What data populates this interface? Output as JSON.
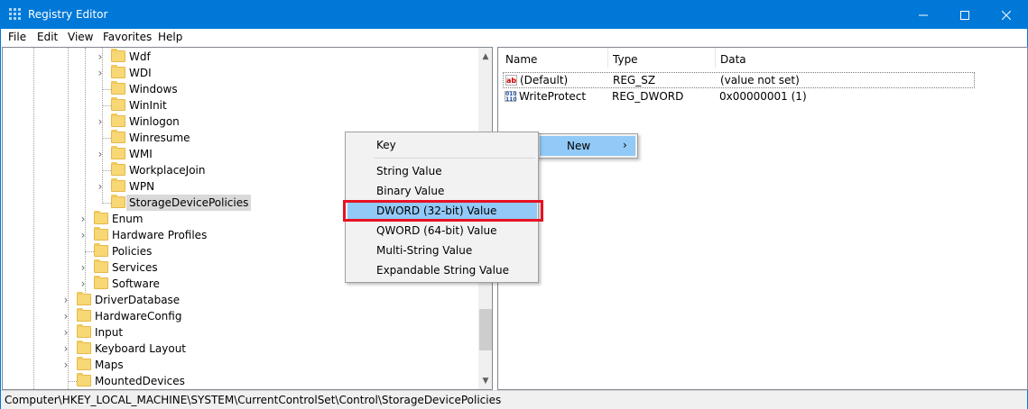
{
  "window": {
    "title": "Registry Editor"
  },
  "menubar": [
    "File",
    "Edit",
    "View",
    "Favorites",
    "Help"
  ],
  "tree": {
    "items": [
      {
        "label": "Wdf",
        "expander": true
      },
      {
        "label": "WDI",
        "expander": true
      },
      {
        "label": "Windows",
        "expander": false
      },
      {
        "label": "WinInit",
        "expander": false
      },
      {
        "label": "Winlogon",
        "expander": true
      },
      {
        "label": "Winresume",
        "expander": false
      },
      {
        "label": "WMI",
        "expander": true
      },
      {
        "label": "WorkplaceJoin",
        "expander": false
      },
      {
        "label": "WPN",
        "expander": true
      },
      {
        "label": "StorageDevicePolicies",
        "expander": false,
        "selected": true
      },
      {
        "label": "Enum",
        "expander": true
      },
      {
        "label": "Hardware Profiles",
        "expander": true
      },
      {
        "label": "Policies",
        "expander": false
      },
      {
        "label": "Services",
        "expander": true
      },
      {
        "label": "Software",
        "expander": true
      },
      {
        "label": "DriverDatabase",
        "expander": true
      },
      {
        "label": "HardwareConfig",
        "expander": true
      },
      {
        "label": "Input",
        "expander": true
      },
      {
        "label": "Keyboard Layout",
        "expander": true
      },
      {
        "label": "Maps",
        "expander": true
      },
      {
        "label": "MountedDevices",
        "expander": false
      }
    ]
  },
  "values": {
    "columns": [
      "Name",
      "Type",
      "Data"
    ],
    "rows": [
      {
        "icon": "string-value-icon",
        "name": "(Default)",
        "type": "REG_SZ",
        "data": "(value not set)"
      },
      {
        "icon": "binary-value-icon",
        "name": "WriteProtect",
        "type": "REG_DWORD",
        "data": "0x00000001 (1)"
      }
    ]
  },
  "context_menu": {
    "items": [
      "Key",
      "String Value",
      "Binary Value",
      "DWORD (32-bit) Value",
      "QWORD (64-bit) Value",
      "Multi-String Value",
      "Expandable String Value"
    ],
    "highlighted": "DWORD (32-bit) Value"
  },
  "submenu": {
    "label": "New",
    "arrow": "›"
  },
  "statusbar": {
    "path": "Computer\\HKEY_LOCAL_MACHINE\\SYSTEM\\CurrentControlSet\\Control\\StorageDevicePolicies"
  },
  "colors": {
    "titlebar": "#0078d7",
    "menu_hover": "#91c9f7",
    "highlight_border": "#e81123",
    "folder": "#f8d775"
  }
}
